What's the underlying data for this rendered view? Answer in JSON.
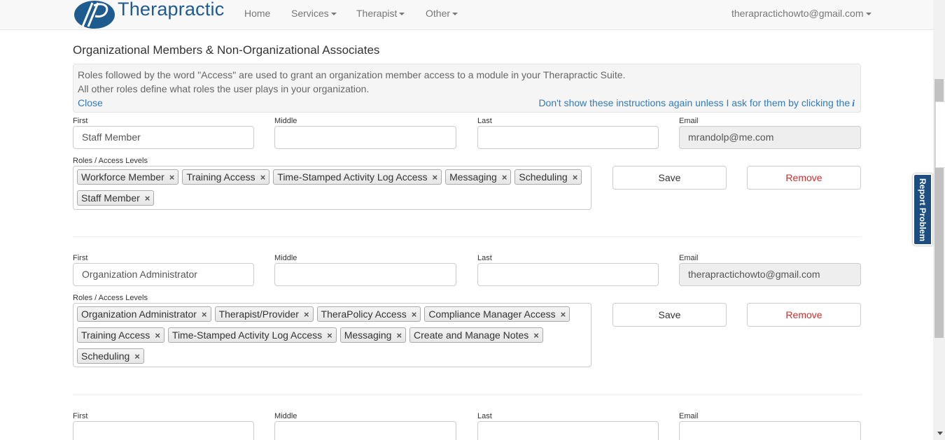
{
  "brand": {
    "name": "Therapractic"
  },
  "nav": {
    "home": "Home",
    "services": "Services",
    "therapist": "Therapist",
    "other": "Other",
    "user_email": "therapractichowto@gmail.com"
  },
  "report_tab": "Report Problem",
  "page_title": "Organizational Members & Non-Organizational Associates",
  "instructions": {
    "line1": "Roles followed by the word \"Access\" are used to grant an organization member access to a module in your Therapractic Suite.",
    "line2": "All other roles define what roles the user plays in your organization.",
    "close": "Close",
    "dismiss": "Don't show these instructions again unless I ask for them by clicking the",
    "info_icon": "i"
  },
  "labels": {
    "first": "First",
    "middle": "Middle",
    "last": "Last",
    "email": "Email",
    "roles": "Roles / Access Levels",
    "save": "Save",
    "remove": "Remove"
  },
  "members": [
    {
      "first": "Staff Member",
      "middle": "",
      "last": "",
      "email": "mrandolp@me.com",
      "roles": [
        [
          "Workforce Member",
          "Training Access",
          "Time-Stamped Activity Log Access",
          "Messaging",
          "Scheduling"
        ],
        [
          "Staff Member"
        ]
      ]
    },
    {
      "first": "Organization Administrator",
      "middle": "",
      "last": "",
      "email": "therapractichowto@gmail.com",
      "roles": [
        [
          "Organization Administrator",
          "Therapist/Provider",
          "TheraPolicy Access",
          "Compliance Manager Access"
        ],
        [
          "Training Access",
          "Time-Stamped Activity Log Access",
          "Messaging",
          "Create and Manage Notes"
        ],
        [
          "Scheduling"
        ]
      ]
    },
    {
      "first": "",
      "middle": "",
      "last": "",
      "email": ""
    }
  ],
  "colors": {
    "brand_blue": "#1e5b8f",
    "link_blue": "#337ab7",
    "remove_red": "#c9302c",
    "report_tab_bg": "#1d4e82"
  }
}
